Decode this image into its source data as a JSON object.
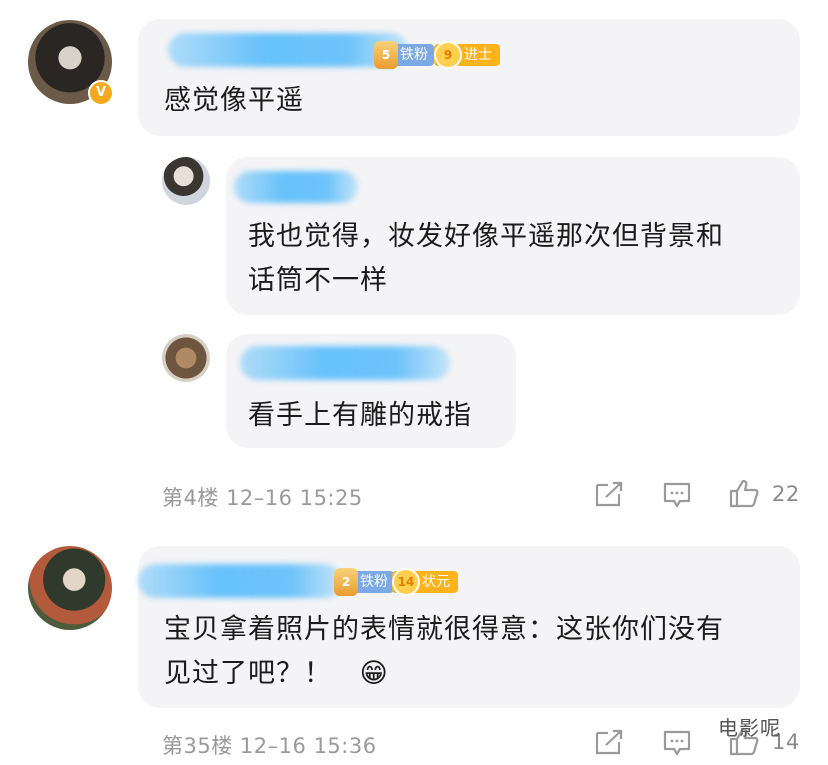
{
  "comments": [
    {
      "text": "感觉像平遥",
      "badges": {
        "fan_level": "5",
        "fan_label": "铁粉",
        "rank_level": "9",
        "rank_label": "进士"
      },
      "verified": "V",
      "replies": [
        {
          "text_lines": [
            "我也觉得，妆发好像平遥那次但背景和",
            "话筒不一样"
          ]
        },
        {
          "text_lines": [
            "看手上有雕的戒指"
          ]
        }
      ],
      "floor": "第4楼",
      "date": "12–16",
      "time": "15:25",
      "likes": "22"
    },
    {
      "text_lines": [
        "宝贝拿着照片的表情就很得意：这张你们没有",
        "见过了吧？！"
      ],
      "emoji": "😁",
      "badges": {
        "fan_level": "2",
        "fan_label": "铁粉",
        "rank_level": "14",
        "rank_label": "状元"
      },
      "floor": "第35楼",
      "date": "12–16",
      "time": "15:36",
      "likes": "14"
    }
  ],
  "watermark": "电影呢",
  "colors": {
    "bubble": "#f4f4f6",
    "fan_badge": "#7aa9e6",
    "rank_badge": "#ffb21a",
    "name_blur": "#5fbefa"
  }
}
